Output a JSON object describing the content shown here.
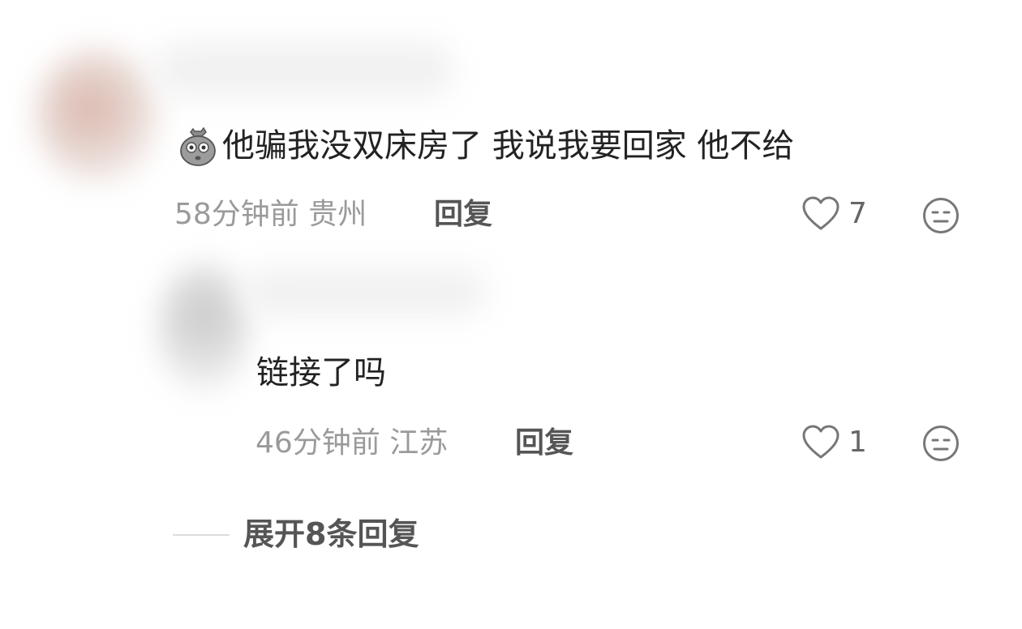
{
  "comments": [
    {
      "text": "他骗我没双床房了 我说我要回家 他不给",
      "emoji": "sack-face-emoji",
      "time": "58分钟前",
      "location": "贵州",
      "reply_label": "回复",
      "like_count": "7"
    },
    {
      "text": "链接了吗",
      "time": "46分钟前",
      "location": "江苏",
      "reply_label": "回复",
      "like_count": "1"
    }
  ],
  "expand_replies_label": "展开8条回复",
  "icons": {
    "like": "heart-outline-icon",
    "dislike": "unamused-face-icon"
  },
  "colors": {
    "text": "#222222",
    "meta": "#9a9a9a",
    "action": "#555555"
  }
}
